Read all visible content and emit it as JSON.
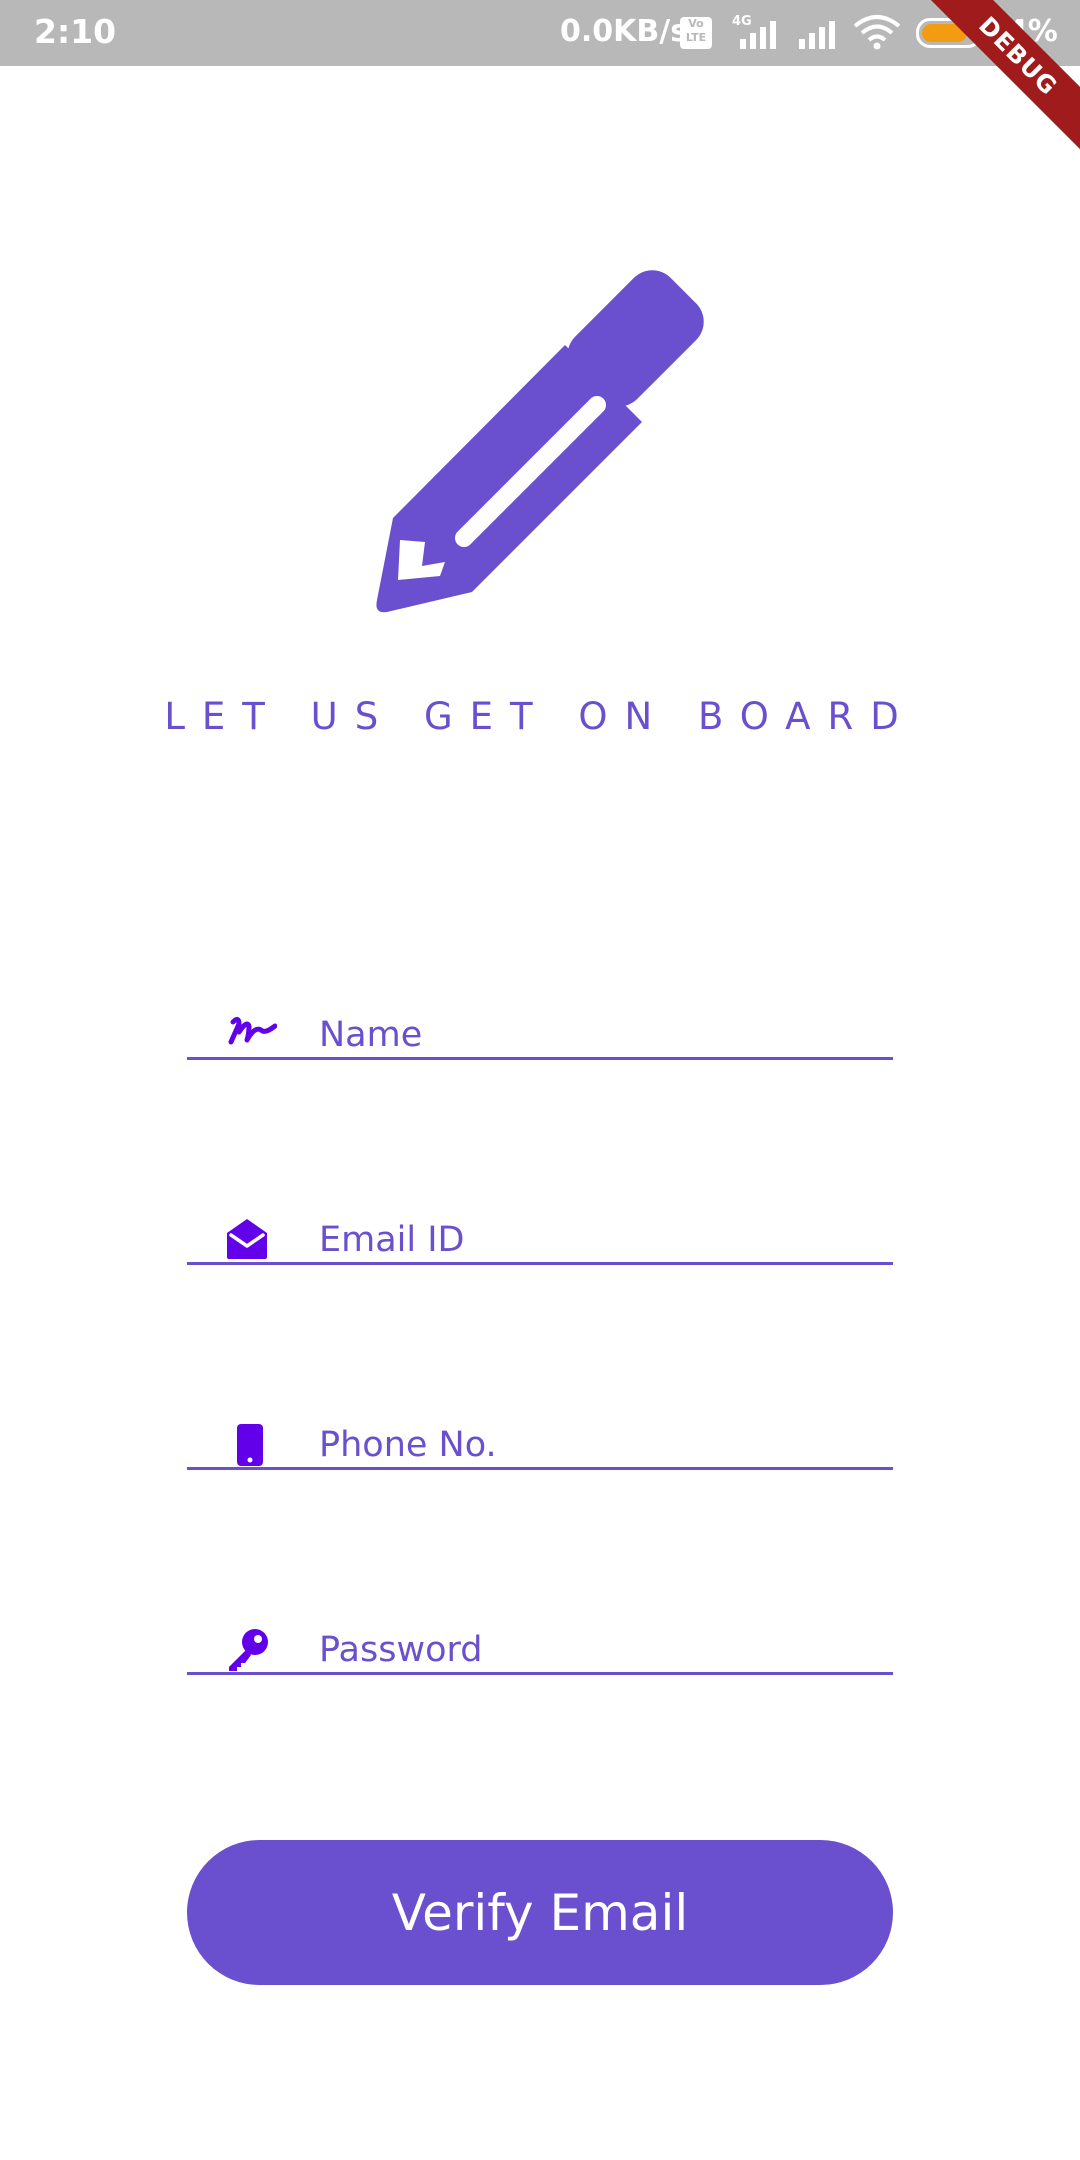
{
  "status_bar": {
    "time": "2:10",
    "network_speed": "0.0KB/s",
    "volte_label": "Vo\nLTE",
    "network_type": "4G",
    "battery_percent": "84%",
    "battery_level": 0.84
  },
  "debug_banner": "DEBUG",
  "header": {
    "title": "LET US GET ON BOARD",
    "icon": "pencil-icon",
    "accent_color": "#6a4fce"
  },
  "form": {
    "name": {
      "placeholder": "Name",
      "icon": "signature-icon"
    },
    "email": {
      "placeholder": "Email ID",
      "icon": "envelope-open-icon"
    },
    "phone": {
      "placeholder": "Phone No.",
      "icon": "mobile-phone-icon"
    },
    "password": {
      "placeholder": "Password",
      "icon": "key-icon"
    }
  },
  "actions": {
    "verify_label": "Verify Email"
  },
  "colors": {
    "primary": "#6a4fce",
    "icon": "#6200ea",
    "status_bar": "#b8b8b8",
    "debug": "#a01c1c"
  }
}
